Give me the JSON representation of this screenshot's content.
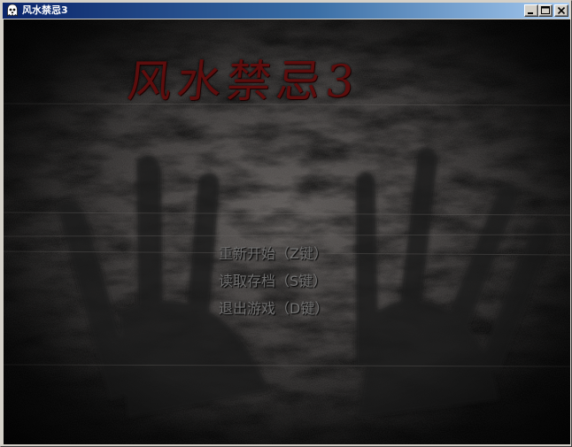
{
  "window": {
    "title": "风水禁忌3",
    "icon": "ghost-app-icon",
    "controls": {
      "minimize_icon": "minimize-icon",
      "maximize_icon": "maximize-icon",
      "close_icon": "close-icon"
    }
  },
  "game": {
    "title": "风水禁忌3",
    "title_color": "#5c0d0d",
    "background": "dark-haunted-hands-artwork",
    "menu": [
      {
        "label": "重新开始（Z键）"
      },
      {
        "label": "读取存档（S键）"
      },
      {
        "label": "退出游戏（D键）"
      }
    ]
  }
}
